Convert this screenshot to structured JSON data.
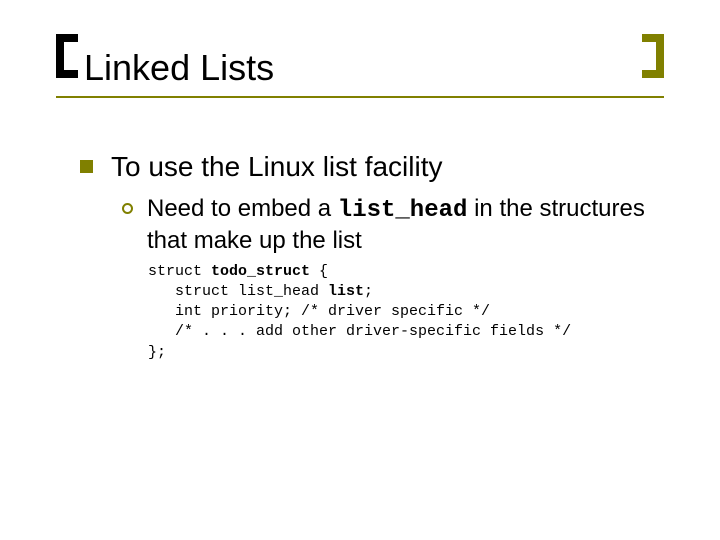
{
  "title": "Linked Lists",
  "body": {
    "lvl1": "To use the Linux list facility",
    "lvl2_pre": "Need to embed a ",
    "lvl2_code": "list_head",
    "lvl2_post": " in the structures that make up the list"
  },
  "code": {
    "l1a": "struct ",
    "l1b": "todo_struct",
    "l1c": " {",
    "l2a": "   struct list_head ",
    "l2b": "list",
    "l2c": ";",
    "l3": "   int priority; /* driver specific */",
    "l4": "   /* . . . add other driver-specific fields */",
    "l5": "};"
  }
}
